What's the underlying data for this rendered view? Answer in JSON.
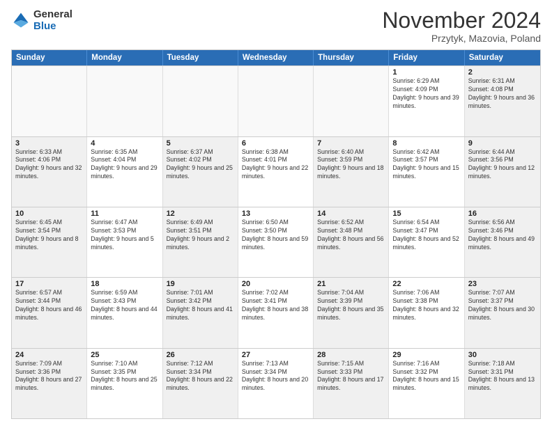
{
  "logo": {
    "line1": "General",
    "line2": "Blue"
  },
  "title": "November 2024",
  "subtitle": "Przytyk, Mazovia, Poland",
  "header": {
    "days": [
      "Sunday",
      "Monday",
      "Tuesday",
      "Wednesday",
      "Thursday",
      "Friday",
      "Saturday"
    ]
  },
  "weeks": [
    [
      {
        "day": "",
        "info": ""
      },
      {
        "day": "",
        "info": ""
      },
      {
        "day": "",
        "info": ""
      },
      {
        "day": "",
        "info": ""
      },
      {
        "day": "",
        "info": ""
      },
      {
        "day": "1",
        "info": "Sunrise: 6:29 AM\nSunset: 4:09 PM\nDaylight: 9 hours\nand 39 minutes."
      },
      {
        "day": "2",
        "info": "Sunrise: 6:31 AM\nSunset: 4:08 PM\nDaylight: 9 hours\nand 36 minutes."
      }
    ],
    [
      {
        "day": "3",
        "info": "Sunrise: 6:33 AM\nSunset: 4:06 PM\nDaylight: 9 hours\nand 32 minutes."
      },
      {
        "day": "4",
        "info": "Sunrise: 6:35 AM\nSunset: 4:04 PM\nDaylight: 9 hours\nand 29 minutes."
      },
      {
        "day": "5",
        "info": "Sunrise: 6:37 AM\nSunset: 4:02 PM\nDaylight: 9 hours\nand 25 minutes."
      },
      {
        "day": "6",
        "info": "Sunrise: 6:38 AM\nSunset: 4:01 PM\nDaylight: 9 hours\nand 22 minutes."
      },
      {
        "day": "7",
        "info": "Sunrise: 6:40 AM\nSunset: 3:59 PM\nDaylight: 9 hours\nand 18 minutes."
      },
      {
        "day": "8",
        "info": "Sunrise: 6:42 AM\nSunset: 3:57 PM\nDaylight: 9 hours\nand 15 minutes."
      },
      {
        "day": "9",
        "info": "Sunrise: 6:44 AM\nSunset: 3:56 PM\nDaylight: 9 hours\nand 12 minutes."
      }
    ],
    [
      {
        "day": "10",
        "info": "Sunrise: 6:45 AM\nSunset: 3:54 PM\nDaylight: 9 hours\nand 8 minutes."
      },
      {
        "day": "11",
        "info": "Sunrise: 6:47 AM\nSunset: 3:53 PM\nDaylight: 9 hours\nand 5 minutes."
      },
      {
        "day": "12",
        "info": "Sunrise: 6:49 AM\nSunset: 3:51 PM\nDaylight: 9 hours\nand 2 minutes."
      },
      {
        "day": "13",
        "info": "Sunrise: 6:50 AM\nSunset: 3:50 PM\nDaylight: 8 hours\nand 59 minutes."
      },
      {
        "day": "14",
        "info": "Sunrise: 6:52 AM\nSunset: 3:48 PM\nDaylight: 8 hours\nand 56 minutes."
      },
      {
        "day": "15",
        "info": "Sunrise: 6:54 AM\nSunset: 3:47 PM\nDaylight: 8 hours\nand 52 minutes."
      },
      {
        "day": "16",
        "info": "Sunrise: 6:56 AM\nSunset: 3:46 PM\nDaylight: 8 hours\nand 49 minutes."
      }
    ],
    [
      {
        "day": "17",
        "info": "Sunrise: 6:57 AM\nSunset: 3:44 PM\nDaylight: 8 hours\nand 46 minutes."
      },
      {
        "day": "18",
        "info": "Sunrise: 6:59 AM\nSunset: 3:43 PM\nDaylight: 8 hours\nand 44 minutes."
      },
      {
        "day": "19",
        "info": "Sunrise: 7:01 AM\nSunset: 3:42 PM\nDaylight: 8 hours\nand 41 minutes."
      },
      {
        "day": "20",
        "info": "Sunrise: 7:02 AM\nSunset: 3:41 PM\nDaylight: 8 hours\nand 38 minutes."
      },
      {
        "day": "21",
        "info": "Sunrise: 7:04 AM\nSunset: 3:39 PM\nDaylight: 8 hours\nand 35 minutes."
      },
      {
        "day": "22",
        "info": "Sunrise: 7:06 AM\nSunset: 3:38 PM\nDaylight: 8 hours\nand 32 minutes."
      },
      {
        "day": "23",
        "info": "Sunrise: 7:07 AM\nSunset: 3:37 PM\nDaylight: 8 hours\nand 30 minutes."
      }
    ],
    [
      {
        "day": "24",
        "info": "Sunrise: 7:09 AM\nSunset: 3:36 PM\nDaylight: 8 hours\nand 27 minutes."
      },
      {
        "day": "25",
        "info": "Sunrise: 7:10 AM\nSunset: 3:35 PM\nDaylight: 8 hours\nand 25 minutes."
      },
      {
        "day": "26",
        "info": "Sunrise: 7:12 AM\nSunset: 3:34 PM\nDaylight: 8 hours\nand 22 minutes."
      },
      {
        "day": "27",
        "info": "Sunrise: 7:13 AM\nSunset: 3:34 PM\nDaylight: 8 hours\nand 20 minutes."
      },
      {
        "day": "28",
        "info": "Sunrise: 7:15 AM\nSunset: 3:33 PM\nDaylight: 8 hours\nand 17 minutes."
      },
      {
        "day": "29",
        "info": "Sunrise: 7:16 AM\nSunset: 3:32 PM\nDaylight: 8 hours\nand 15 minutes."
      },
      {
        "day": "30",
        "info": "Sunrise: 7:18 AM\nSunset: 3:31 PM\nDaylight: 8 hours\nand 13 minutes."
      }
    ]
  ]
}
